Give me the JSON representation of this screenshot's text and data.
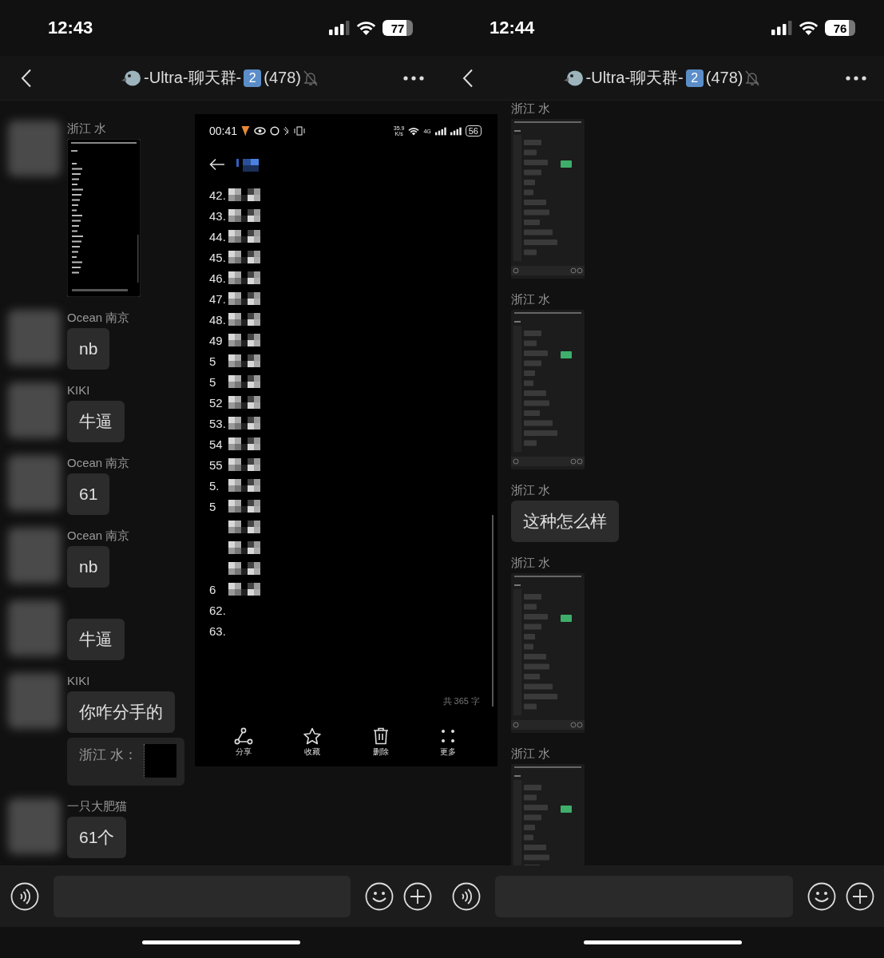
{
  "panels": [
    {
      "status_bar": {
        "time": "12:43",
        "battery": "77"
      },
      "nav": {
        "title": "-Ultra-聊天群-",
        "badge": "2",
        "count": "(478)",
        "muted": true
      },
      "messages": [
        {
          "sender": "浙江 水",
          "kind": "note_image"
        },
        {
          "sender": "Ocean 南京",
          "kind": "text",
          "text": "nb"
        },
        {
          "sender": "KIKI",
          "kind": "text",
          "text": "牛逼"
        },
        {
          "sender": "Ocean 南京",
          "kind": "text",
          "text": "61"
        },
        {
          "sender": "Ocean 南京",
          "kind": "text",
          "text": "nb"
        },
        {
          "kind": "text",
          "text": "牛逼"
        },
        {
          "sender": "KIKI",
          "kind": "text",
          "text": "你咋分手的",
          "quote": "浙江 水："
        },
        {
          "sender": "一只大肥猫",
          "kind": "text",
          "text": "61个"
        }
      ],
      "overlay": {
        "time": "00:41",
        "speed": "35.9",
        "speed_unit": "K/s",
        "network": "4G",
        "battery": "56",
        "rows": [
          {
            "label": "42.",
            "masked": true
          },
          {
            "label": "43.",
            "masked": true
          },
          {
            "label": "44.",
            "masked": true
          },
          {
            "label": "45.",
            "masked": true
          },
          {
            "label": "46.",
            "masked": true
          },
          {
            "label": "47.",
            "masked": true
          },
          {
            "label": "48.",
            "masked": true
          },
          {
            "label": "49",
            "masked": true
          },
          {
            "label": "5",
            "masked": true
          },
          {
            "label": "5",
            "masked": true
          },
          {
            "label": "52",
            "masked": true
          },
          {
            "label": "53.",
            "masked": true
          },
          {
            "label": "54",
            "masked": true
          },
          {
            "label": "55",
            "masked": true
          },
          {
            "label": "5.",
            "masked": true
          },
          {
            "label": "5",
            "masked": true
          },
          {
            "masked": true
          },
          {
            "masked": true
          },
          {
            "masked": true
          },
          {
            "label": "6",
            "masked": true
          },
          {
            "label": "62.",
            "masked": false
          },
          {
            "label": "63.",
            "masked": false
          }
        ],
        "word_count": "共 365 字",
        "actions": [
          {
            "kind": "share",
            "label": "分享"
          },
          {
            "kind": "star",
            "label": "收藏"
          },
          {
            "kind": "trash",
            "label": "删除"
          },
          {
            "kind": "more",
            "label": "更多"
          }
        ]
      }
    },
    {
      "status_bar": {
        "time": "12:44",
        "battery": "76"
      },
      "nav": {
        "title": "-Ultra-聊天群-",
        "badge": "2",
        "count": "(478)",
        "muted": true
      },
      "messages": [
        {
          "sender": "浙江 水",
          "kind": "chat_image"
        },
        {
          "sender": "浙江 水",
          "kind": "chat_image"
        },
        {
          "sender": "浙江 水",
          "kind": "text",
          "text": "这种怎么样"
        },
        {
          "sender": "浙江 水",
          "kind": "chat_image"
        },
        {
          "sender": "浙江 水",
          "kind": "chat_image"
        }
      ]
    }
  ]
}
